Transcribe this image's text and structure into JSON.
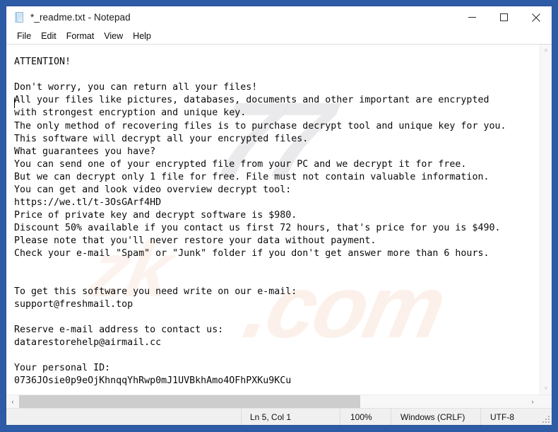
{
  "window": {
    "title": "*_readme.txt - Notepad",
    "icon": "notepad-document-icon",
    "border_color": "#2b579a",
    "controls": {
      "minimize": "Minimize",
      "maximize": "Maximize",
      "close": "Close"
    }
  },
  "menubar": {
    "items": [
      {
        "label": "File"
      },
      {
        "label": "Edit"
      },
      {
        "label": "Format"
      },
      {
        "label": "View"
      },
      {
        "label": "Help"
      }
    ]
  },
  "document": {
    "filename": "*_readme.txt",
    "watermarks": [
      "77",
      ".com",
      "zk"
    ],
    "lines": [
      "ATTENTION!",
      "",
      "Don't worry, you can return all your files!",
      "All your files like pictures, databases, documents and other important are encrypted",
      "with strongest encryption and unique key.",
      "The only method of recovering files is to purchase decrypt tool and unique key for you.",
      "This software will decrypt all your encrypted files.",
      "What guarantees you have?",
      "You can send one of your encrypted file from your PC and we decrypt it for free.",
      "But we can decrypt only 1 file for free. File must not contain valuable information.",
      "You can get and look video overview decrypt tool:",
      "https://we.tl/t-3OsGArf4HD",
      "Price of private key and decrypt software is $980.",
      "Discount 50% available if you contact us first 72 hours, that's price for you is $490.",
      "Please note that you'll never restore your data without payment.",
      "Check your e-mail \"Spam\" or \"Junk\" folder if you don't get answer more than 6 hours.",
      "",
      "",
      "To get this software you need write on our e-mail:",
      "support@freshmail.top",
      "",
      "Reserve e-mail address to contact us:",
      "datarestorehelp@airmail.cc",
      "",
      "Your personal ID:",
      "0736JOsie0p9eOjKhnqqYhRwp0mJ1UVBkhAmo4OFhPXKu9KCu"
    ],
    "video_url": "https://we.tl/t-3OsGArf4HD",
    "price_full": "$980",
    "price_discount": "$490",
    "discount_percent": "50%",
    "discount_window_hours": "72",
    "reply_window_hours": "6",
    "primary_email": "support@freshmail.top",
    "reserve_email": "datarestorehelp@airmail.cc",
    "personal_id": "0736JOsie0p9eOjKhnqqYhRwp0mJ1UVBkhAmo4OFhPXKu9KCu"
  },
  "scrollbars": {
    "vertical": {
      "up_arrow": "˄",
      "down_arrow": "˅"
    },
    "horizontal": {
      "left_arrow": "‹",
      "right_arrow": "›"
    }
  },
  "statusbar": {
    "cursor_position": "Ln 5, Col 1",
    "zoom": "100%",
    "line_ending": "Windows (CRLF)",
    "encoding": "UTF-8"
  }
}
